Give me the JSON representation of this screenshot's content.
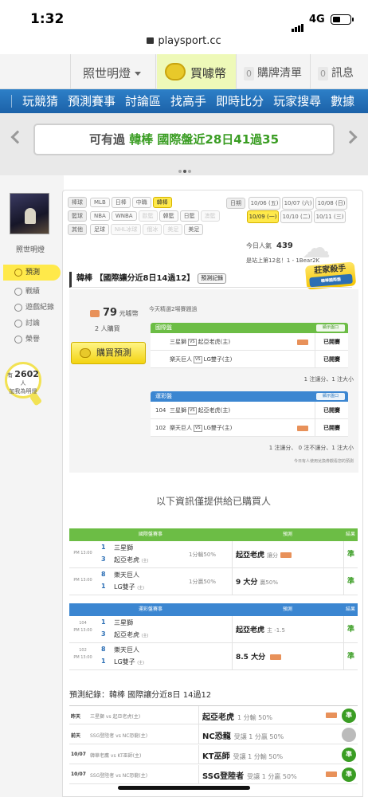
{
  "status": {
    "time": "1:32",
    "network": "4G"
  },
  "browser": {
    "url": "playsport.cc"
  },
  "topnav": {
    "user": "照世明燈",
    "buy_coin": "買噱幣",
    "cart_count": "0",
    "cart": "購牌清單",
    "msg_count": "0",
    "msg": "訊息"
  },
  "mainnav": [
    "玩競猜",
    "預測賽事",
    "討論區",
    "找高手",
    "即時比分",
    "玩家搜尋",
    "數據"
  ],
  "banner": {
    "prefix": "可有過",
    "highlight": "韓棒 國際盤近28日41過35"
  },
  "profile": {
    "name": "照世明燈",
    "menu": [
      "預測",
      "戰績",
      "遊戲紀錄",
      "討論",
      "榮譽"
    ],
    "followers": "2602",
    "followers_unit": "人",
    "followers_prefix": "有",
    "followers_text": "加我為明燈"
  },
  "filters": {
    "rows": [
      {
        "label": "棒球",
        "tags": [
          {
            "t": "MLB"
          },
          {
            "t": "日棒"
          },
          {
            "t": "中職"
          },
          {
            "t": "韓棒",
            "on": true
          }
        ]
      },
      {
        "label": "籃球",
        "tags": [
          {
            "t": "NBA"
          },
          {
            "t": "WNBA"
          },
          {
            "t": "歐籃",
            "dim": true
          },
          {
            "t": "韓籃"
          },
          {
            "t": "日籃"
          },
          {
            "t": "澳籃",
            "dim": true
          }
        ]
      },
      {
        "label": "其他",
        "tags": [
          {
            "t": "足球"
          },
          {
            "t": "NHL冰球",
            "dim": true
          },
          {
            "t": "俄冰",
            "dim": true
          },
          {
            "t": "美足",
            "dim": true
          },
          {
            "t": "美足"
          }
        ]
      }
    ],
    "date_label": "日期",
    "dates": [
      {
        "t": "10/06 (五)"
      },
      {
        "t": "10/07 (六)"
      },
      {
        "t": "10/08 (日)"
      },
      {
        "t": "10/09 (一)",
        "on": true
      },
      {
        "t": "10/10 (二)"
      },
      {
        "t": "10/11 (三)"
      }
    ]
  },
  "stats": {
    "pop_label": "今日人氣",
    "pop_value": "439",
    "rank_text": "是站上第12名！1 - 1Bear2K"
  },
  "badge": {
    "title": "莊家殺手",
    "sub": "韓棒國際盤"
  },
  "prediction": {
    "title": "韓棒 【國際讓分近8日14過12】",
    "record_btn": "預測記錄",
    "price": "79",
    "price_unit": "元噱幣",
    "buyers": "2 人購買",
    "buy_btn": "購買預測",
    "hint": "今天精選2場賽題過",
    "intl_title": "國際盤",
    "show_btn": "顯示盤口",
    "intl_rows": [
      {
        "n": "",
        "away": "三星獅",
        "home": "起亞老虎(主)",
        "hot": true,
        "state": "已開賽"
      },
      {
        "n": "",
        "away": "樂天巨人",
        "home": "LG雙子(主)",
        "hot": false,
        "state": "已開賽"
      }
    ],
    "intl_sum": "1 注讓分、1 注大小",
    "tw_title": "運彩盤",
    "tw_rows": [
      {
        "n": "104",
        "away": "三星獅",
        "home": "起亞老虎(主)",
        "hot": false,
        "state": "已開賽"
      },
      {
        "n": "102",
        "away": "樂天巨人",
        "home": "LG雙子(主)",
        "hot": true,
        "state": "已開賽"
      }
    ],
    "tw_sum": "1 注讓分、 0 注不讓分、1 注大小",
    "coupon": "今日有人使用兌換券觀看您的預測"
  },
  "info_note": "以下資訊僅提供給已購買人",
  "results": {
    "intl_header": {
      "game": "國際盤賽事",
      "pick": "預測",
      "result": "結果"
    },
    "intl_rows": [
      {
        "time": "PM 13:00",
        "s1": "1",
        "t1": "三星獅",
        "s2": "3",
        "t2": "起亞老虎",
        "line": "1分輸50%",
        "pick": "起亞老虎",
        "pick_note": "讓分",
        "hot": true,
        "res": "準"
      },
      {
        "time": "PM 13:00",
        "s1": "8",
        "t1": "樂天巨人",
        "s2": "1",
        "t2": "LG雙子",
        "line": "1分贏50%",
        "pick": "9 大分",
        "pick_note": "贏50%",
        "hot": false,
        "res": "準"
      }
    ],
    "tw_header": {
      "game": "運彩盤賽事",
      "pick": "預測",
      "result": "結果"
    },
    "tw_rows": [
      {
        "num": "104",
        "time": "PM 13:00",
        "s1": "1",
        "t1": "三星獅",
        "s2": "3",
        "t2": "起亞老虎",
        "pick": "起亞老虎",
        "pick_note": "主 -1.5",
        "hot": false,
        "res": "準"
      },
      {
        "num": "102",
        "time": "PM 13:00",
        "s1": "8",
        "t1": "樂天巨人",
        "s2": "1",
        "t2": "LG雙子",
        "pick": "8.5 大分",
        "pick_note": "",
        "hot": true,
        "res": "準"
      }
    ]
  },
  "history": {
    "title": "預測紀錄：韓棒 國際讓分近8日 14過12",
    "rows": [
      {
        "d": "昨天",
        "m": "三星獅 vs 起亞老虎(主)",
        "p": "起亞老虎",
        "note": "1 分輸 50%",
        "hot": true,
        "r": "準",
        "g": false
      },
      {
        "d": "前天",
        "m": "SSG登陸者 vs NC恐龍(主)",
        "p": "NC恐龍",
        "note": "受讓 1 分贏 50%",
        "hot": false,
        "r": "",
        "g": true
      },
      {
        "d": "10/07",
        "m": "韓華老鷹 vs KT巫師(主)",
        "p": "KT巫師",
        "note": "受讓 1 分輸 50%",
        "hot": false,
        "r": "準",
        "g": false
      },
      {
        "d": "10/07",
        "m": "SSG登陸者 vs NC恐龍(主)",
        "p": "SSG登陸者",
        "note": "受讓 1 分贏 50%",
        "hot": true,
        "r": "準",
        "g": false
      }
    ]
  },
  "colors": {
    "accent_blue": "#1f6fb8",
    "green": "#6cbd45",
    "yellow": "#ffe94a"
  }
}
